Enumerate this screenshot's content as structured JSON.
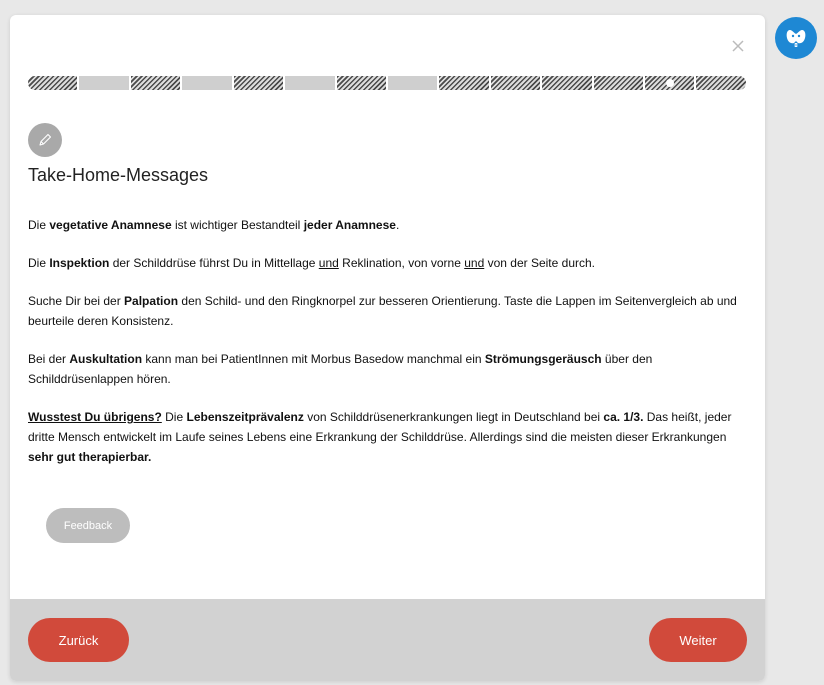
{
  "progress": {
    "segments": [
      "done",
      "todo",
      "done",
      "todo",
      "done",
      "todo",
      "done",
      "todo",
      "done",
      "done",
      "done",
      "done",
      "current",
      "done"
    ]
  },
  "title": "Take-Home-Messages",
  "messages": {
    "p1": {
      "t1": "Die ",
      "b1": "vegetative Anamnese",
      "t2": " ist wichtiger Bestandteil ",
      "b2": "jeder Anamnese",
      "t3": "."
    },
    "p2": {
      "t1": "Die ",
      "b1": "Inspektion",
      "t2": " der Schilddrüse führst Du in Mittellage ",
      "u1": "und",
      "t3": " Reklination, von vorne ",
      "u2": "und",
      "t4": " von der Seite durch."
    },
    "p3": {
      "t1": "Suche Dir bei der ",
      "b1": "Palpation",
      "t2": " den Schild- und den Ringknorpel zur besseren Orientierung. Taste die Lappen im Seitenvergleich ab und beurteile deren Konsistenz."
    },
    "p4": {
      "t1": "Bei der ",
      "b1": "Auskultation",
      "t2": " kann man bei PatientInnen mit Morbus Basedow manchmal ein ",
      "b2": "Strömungsgeräusch",
      "t3": " über den Schilddrüsenlappen hören."
    },
    "p5": {
      "bu1": "Wusstest Du übrigens?",
      "t1": " Die ",
      "b1": "Lebenszeitprävalenz",
      "t2": " von Schilddrüsenerkrankungen liegt in Deutschland bei ",
      "b2": "ca. 1/3.",
      "t3": " Das heißt, jeder dritte Mensch entwickelt im Laufe seines Lebens eine Erkrankung der Schilddrüse. Allerdings sind die meisten dieser Erkrankungen ",
      "b3": "sehr gut therapierbar."
    }
  },
  "feedback_label": "Feedback",
  "footer": {
    "back_label": "Zurück",
    "next_label": "Weiter"
  },
  "icons": {
    "close": "close-icon",
    "pencil": "pencil-icon",
    "avatar": "thyroid-mascot-icon"
  },
  "colors": {
    "accent": "#d14a3b",
    "avatar_bg": "#1e88d4",
    "footer_bg": "#d2d2d2"
  }
}
